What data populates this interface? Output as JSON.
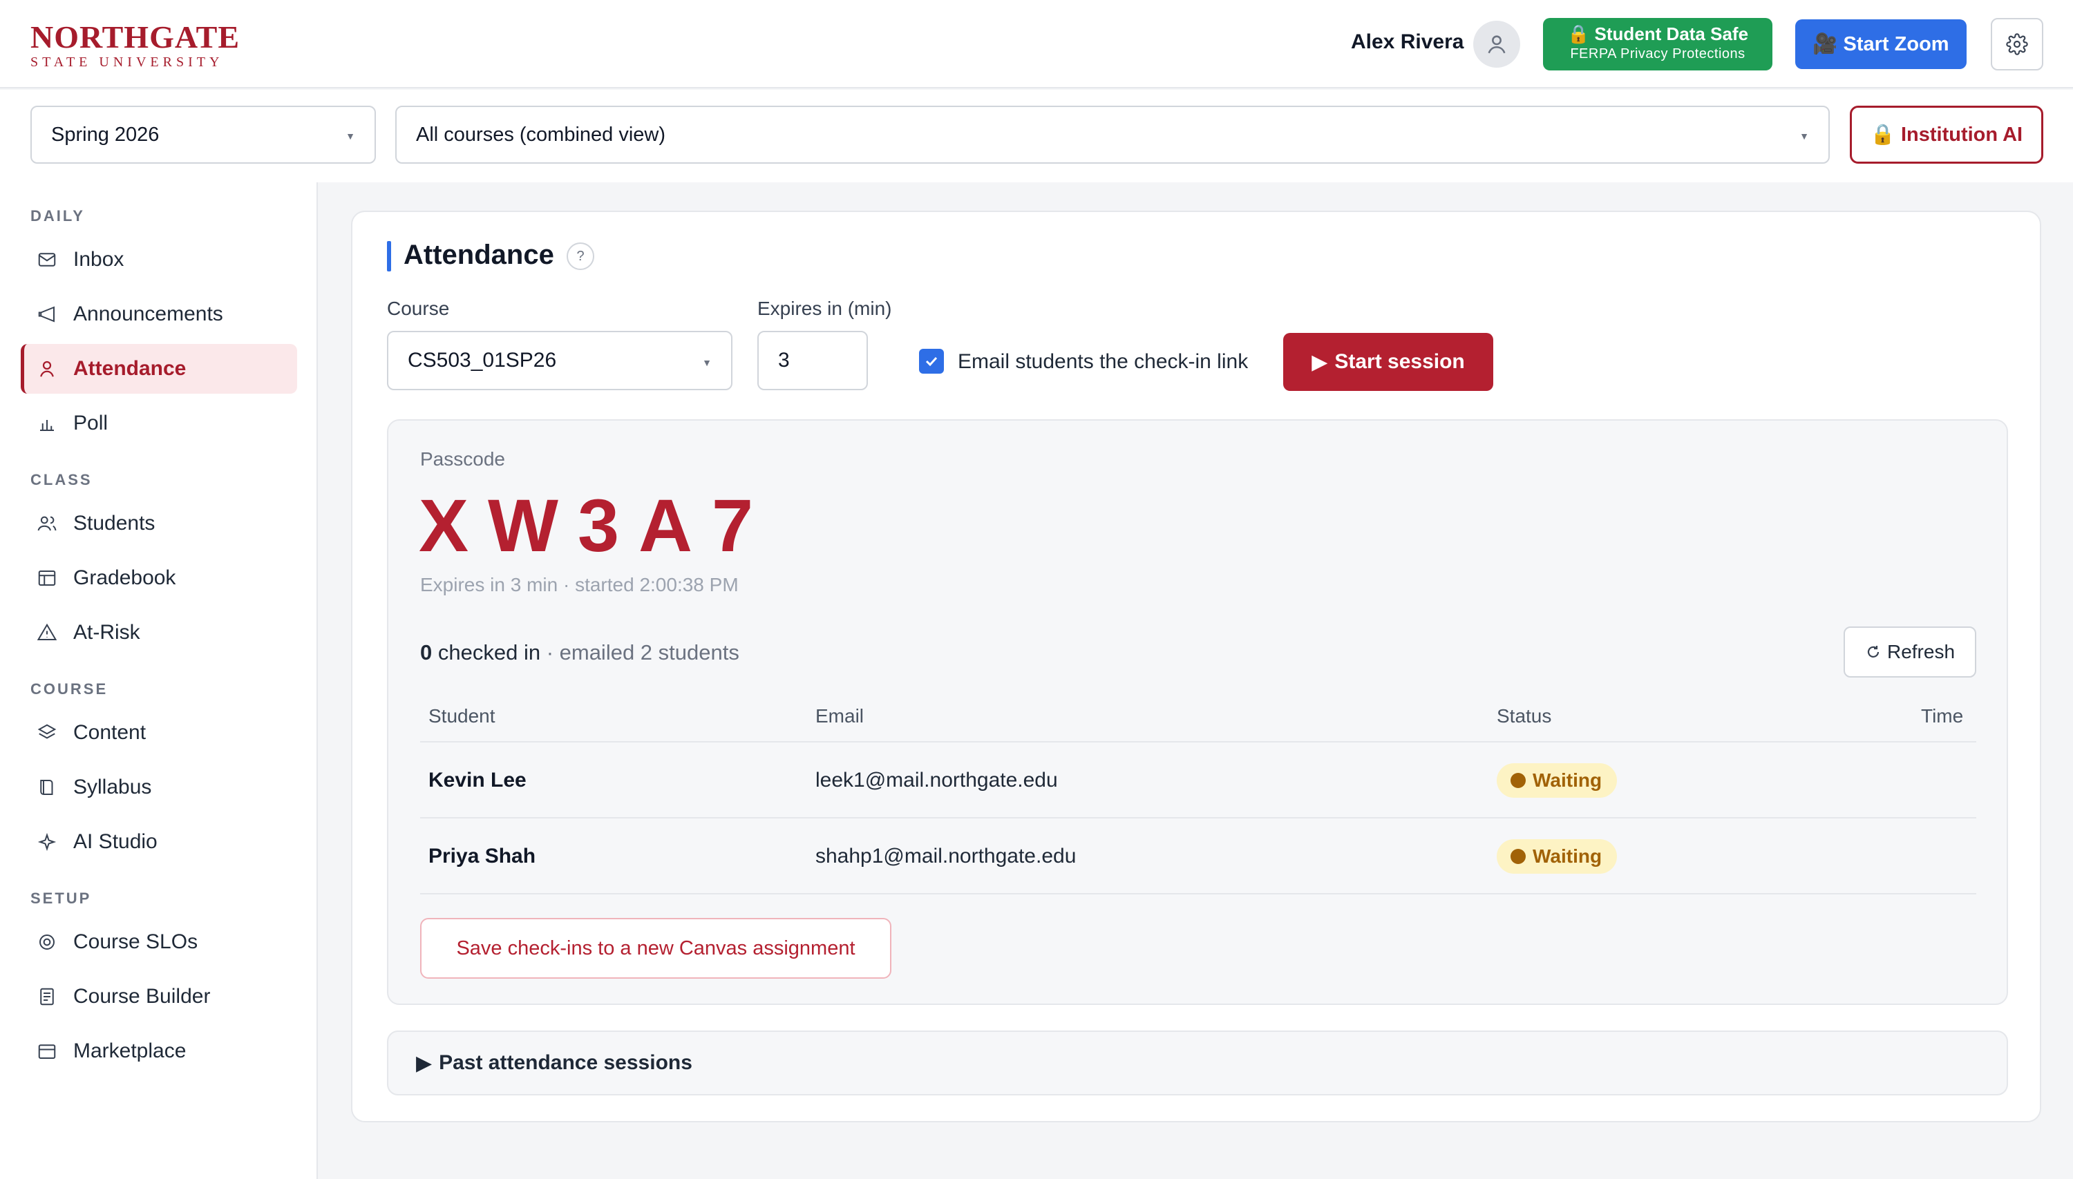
{
  "header": {
    "logo_main": "NORTHGATE",
    "logo_sub": "STATE UNIVERSITY",
    "user_name": "Alex Rivera",
    "safe_title": "🔒 Student Data Safe",
    "safe_subtitle": "FERPA Privacy Protections",
    "zoom_label": "Start Zoom",
    "zoom_icon": "🎥"
  },
  "filters": {
    "term": "Spring 2026",
    "course_scope": "All courses (combined view)",
    "institution_ai": "Institution AI",
    "institution_ai_icon": "🔒"
  },
  "sidebar": {
    "sections": [
      {
        "label": "DAILY",
        "items": [
          {
            "label": "Inbox",
            "icon": "mail-icon"
          },
          {
            "label": "Announcements",
            "icon": "megaphone-icon"
          },
          {
            "label": "Attendance",
            "icon": "person-icon",
            "active": true
          },
          {
            "label": "Poll",
            "icon": "bar-chart-icon"
          }
        ]
      },
      {
        "label": "CLASS",
        "items": [
          {
            "label": "Students",
            "icon": "users-icon"
          },
          {
            "label": "Gradebook",
            "icon": "table-icon"
          },
          {
            "label": "At-Risk",
            "icon": "warning-icon"
          }
        ]
      },
      {
        "label": "COURSE",
        "items": [
          {
            "label": "Content",
            "icon": "layers-icon"
          },
          {
            "label": "Syllabus",
            "icon": "book-icon"
          },
          {
            "label": "AI Studio",
            "icon": "sparkle-icon"
          }
        ]
      },
      {
        "label": "SETUP",
        "items": [
          {
            "label": "Course SLOs",
            "icon": "target-icon"
          },
          {
            "label": "Course Builder",
            "icon": "document-icon"
          },
          {
            "label": "Marketplace",
            "icon": "store-icon"
          }
        ]
      }
    ]
  },
  "attendance": {
    "title": "Attendance",
    "help": "?",
    "course_label": "Course",
    "course_value": "CS503_01SP26",
    "expires_label": "Expires in (min)",
    "expires_value": "3",
    "email_checkbox_label": "Email students the check-in link",
    "email_checked": true,
    "start_label": "Start session",
    "start_icon": "▶",
    "session": {
      "passcode_label": "Passcode",
      "passcode": "XW3A7",
      "meta": "Expires in 3 min · started 2:00:38 PM",
      "checked_in_count": "0",
      "checked_in_text": " checked in",
      "emailed_text": " · emailed 2 students",
      "refresh_label": "Refresh",
      "columns": [
        "Student",
        "Email",
        "Status",
        "Time"
      ],
      "rows": [
        {
          "student": "Kevin Lee",
          "email": "leek1@mail.northgate.edu",
          "status": "Waiting",
          "time": ""
        },
        {
          "student": "Priya Shah",
          "email": "shahp1@mail.northgate.edu",
          "status": "Waiting",
          "time": ""
        }
      ],
      "save_label": "Save check-ins to a new Canvas assignment"
    },
    "past_label": "Past attendance sessions",
    "past_icon": "▶"
  },
  "colors": {
    "brand": "#a61c2c",
    "primary_red": "#b42030",
    "blue": "#2e6ee6",
    "green": "#1f9d55",
    "waiting_bg": "#fdf3c4",
    "waiting_fg": "#a16207"
  }
}
